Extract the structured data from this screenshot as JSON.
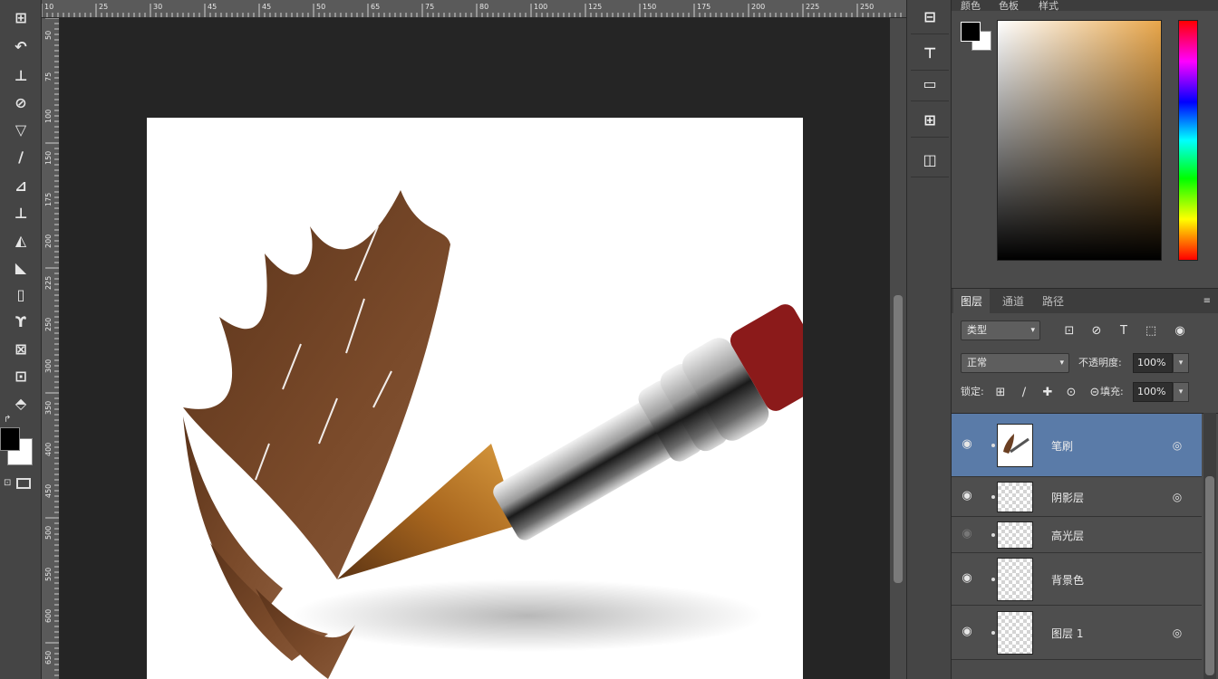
{
  "tools": [
    {
      "name": "move-tool-icon",
      "glyph": "⊞"
    },
    {
      "name": "lasso-tool-icon",
      "glyph": "↶"
    },
    {
      "name": "crop-tool-icon",
      "glyph": "⊥"
    },
    {
      "name": "eyedropper-tool-icon",
      "glyph": "⊘"
    },
    {
      "name": "healing-tool-icon",
      "glyph": "▽"
    },
    {
      "name": "brush-tool-icon",
      "glyph": "∕"
    },
    {
      "name": "stamp-tool-icon",
      "glyph": "⊿"
    },
    {
      "name": "history-brush-tool-icon",
      "glyph": "⊥"
    },
    {
      "name": "eraser-tool-icon",
      "glyph": "◭"
    },
    {
      "name": "gradient-tool-icon",
      "glyph": "◣"
    },
    {
      "name": "blur-tool-icon",
      "glyph": "▯"
    },
    {
      "name": "dodge-tool-icon",
      "glyph": "ϒ"
    },
    {
      "name": "pen-tool-icon",
      "glyph": "⊠"
    },
    {
      "name": "type-tool-icon",
      "glyph": "⊡"
    },
    {
      "name": "shape-tool-icon",
      "glyph": "⬘"
    }
  ],
  "toolbar_glyphs": {
    "swap": "↱",
    "default": "⊡"
  },
  "ruler_top_labels": [
    "10",
    "25",
    "30",
    "45",
    "45",
    "50",
    "65",
    "75",
    "80",
    "100",
    "125",
    "150",
    "175",
    "200",
    "225",
    "250"
  ],
  "ruler_left_labels": [
    "50",
    "75",
    "100",
    "150",
    "175",
    "200",
    "225",
    "250",
    "300",
    "350",
    "400",
    "450",
    "500",
    "550",
    "600",
    "650"
  ],
  "strip_buttons": [
    {
      "name": "history-panel-icon",
      "glyph": "⊟"
    },
    {
      "name": "properties-panel-icon",
      "glyph": "⊤"
    },
    {
      "name": "brush-presets-panel-icon",
      "glyph": "▭"
    },
    {
      "name": "adjustments-panel-icon",
      "glyph": "⊞"
    },
    {
      "name": "paragraph-panel-icon",
      "glyph": "◫"
    }
  ],
  "color_panel": {
    "tab1": "颜色",
    "tab2": "色板",
    "tab3": "样式"
  },
  "layers_panel": {
    "tabs": [
      "图层",
      "通道",
      "路径"
    ],
    "menu_glyph": "≡",
    "filter_kind": "类型",
    "filter_icons": [
      "⊡",
      "⊘",
      "T",
      "⬚",
      "◉"
    ],
    "blend_mode": "正常",
    "opacity_label": "不透明度:",
    "opacity_value": "100%",
    "lock_label": "锁定:",
    "lock_icons": [
      "⊞",
      "∕",
      "✚",
      "⊙",
      "⊝"
    ],
    "fill_label": "填充:",
    "fill_value": "100%",
    "caret": "▾",
    "layers": [
      {
        "name": "笔刷",
        "visible": true,
        "selected": true,
        "fx": true
      },
      {
        "name": "阴影层",
        "visible": true,
        "selected": false,
        "fx": true
      },
      {
        "name": "高光层",
        "visible": false,
        "selected": false,
        "fx": false
      },
      {
        "name": "背景色",
        "visible": true,
        "selected": false,
        "fx": false
      },
      {
        "name": "图层 1",
        "visible": true,
        "selected": false,
        "fx": true
      }
    ],
    "eye_glyph": "◉",
    "fx_glyph": "◎"
  },
  "colors": {
    "accent_selected": "#5a7ba8",
    "brush_brown": "#6b3f22"
  }
}
